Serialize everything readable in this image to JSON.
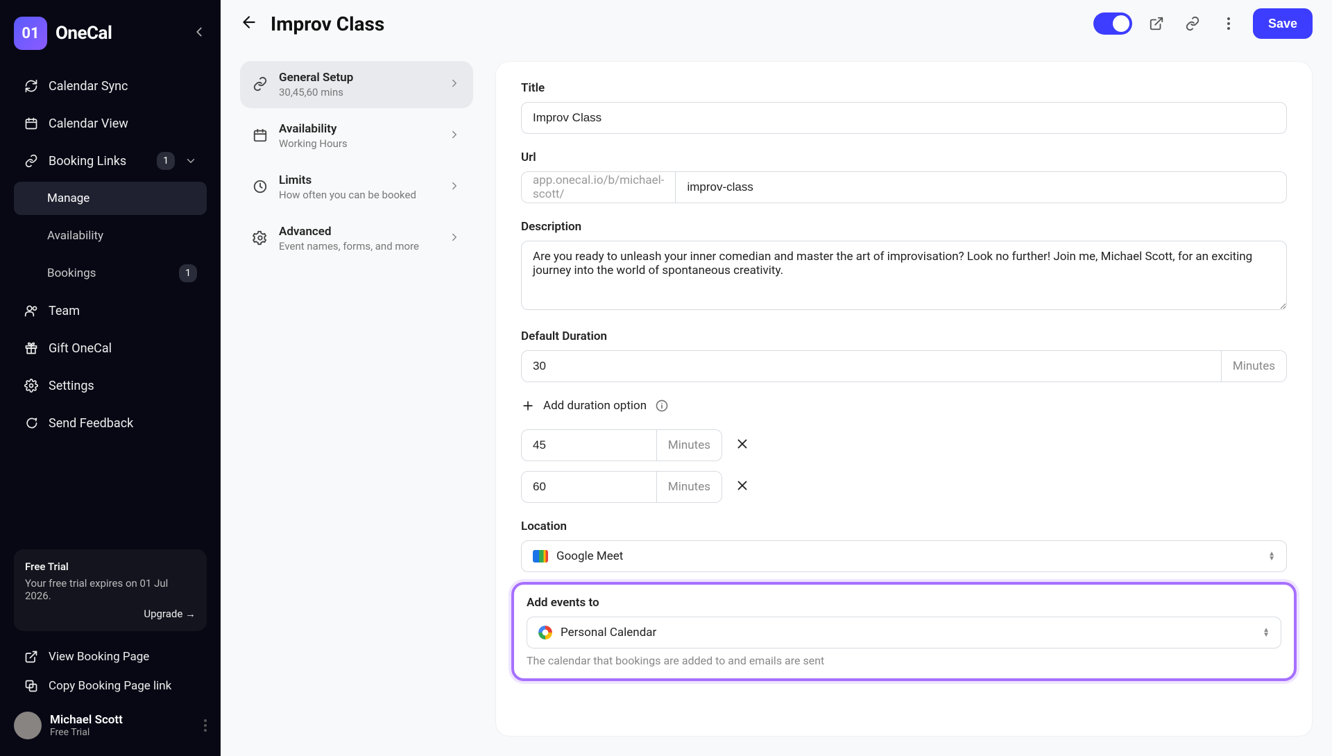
{
  "brand": {
    "name": "OneCal",
    "mark": "01"
  },
  "sidebar": {
    "items": [
      {
        "label": "Calendar Sync"
      },
      {
        "label": "Calendar View"
      },
      {
        "label": "Booking Links",
        "badge": "1"
      },
      {
        "label": "Manage"
      },
      {
        "label": "Availability"
      },
      {
        "label": "Bookings",
        "badge": "1"
      },
      {
        "label": "Team"
      },
      {
        "label": "Gift OneCal"
      },
      {
        "label": "Settings"
      },
      {
        "label": "Send Feedback"
      }
    ],
    "trial": {
      "title": "Free Trial",
      "body": "Your free trial expires on 01 Jul 2026.",
      "upgrade": "Upgrade →"
    },
    "bottomLinks": {
      "viewPage": "View Booking Page",
      "copyLink": "Copy Booking Page link"
    },
    "user": {
      "name": "Michael Scott",
      "plan": "Free Trial"
    }
  },
  "header": {
    "title": "Improv Class",
    "save": "Save"
  },
  "settingsNav": [
    {
      "title": "General Setup",
      "sub": "30,45,60 mins"
    },
    {
      "title": "Availability",
      "sub": "Working Hours"
    },
    {
      "title": "Limits",
      "sub": "How often you can be booked"
    },
    {
      "title": "Advanced",
      "sub": "Event names, forms, and more"
    }
  ],
  "form": {
    "titleLabel": "Title",
    "titleValue": "Improv Class",
    "urlLabel": "Url",
    "urlPrefix": "app.onecal.io/b/michael-scott/",
    "urlSlug": "improv-class",
    "descLabel": "Description",
    "descValue": "Are you ready to unleash your inner comedian and master the art of improvisation? Look no further! Join me, Michael Scott, for an exciting journey into the world of spontaneous creativity.",
    "durLabel": "Default Duration",
    "durValue": "30",
    "durUnit": "Minutes",
    "addDurOpt": "Add duration option",
    "extraDurations": [
      "45",
      "60"
    ],
    "locLabel": "Location",
    "locValue": "Google Meet",
    "addEventsLabel": "Add events to",
    "addEventsValue": "Personal Calendar",
    "addEventsHelp": "The calendar that bookings are added to and emails are sent"
  }
}
